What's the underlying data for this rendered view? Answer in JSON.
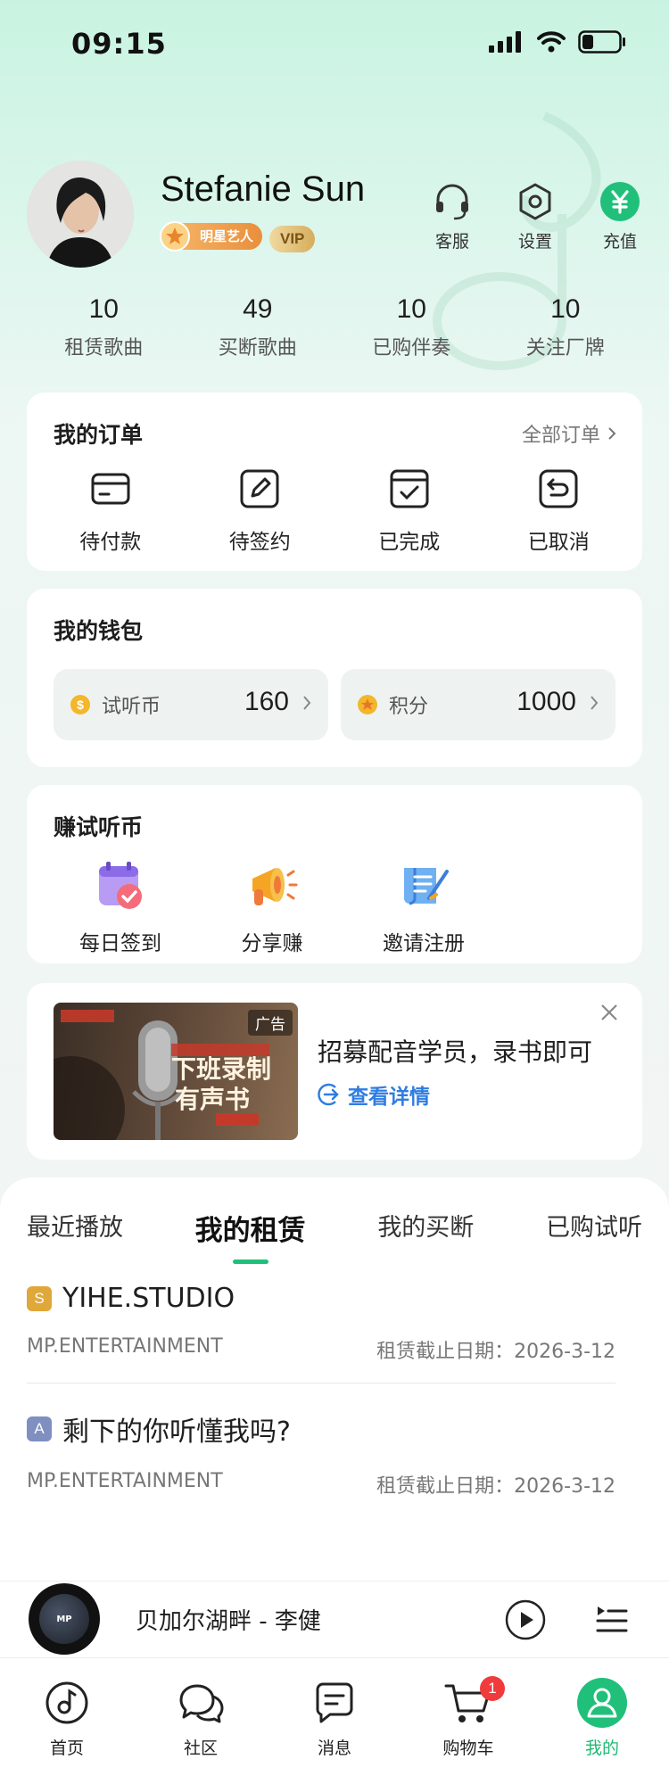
{
  "status_bar": {
    "time": "09:15"
  },
  "profile": {
    "name": "Stefanie Sun",
    "badge_star": "明星艺人",
    "badge_vip": "VIP",
    "actions": [
      {
        "label": "客服",
        "icon": "headset-icon"
      },
      {
        "label": "设置",
        "icon": "settings-hexagon-icon"
      },
      {
        "label": "充值",
        "icon": "yuan-icon"
      }
    ]
  },
  "stats": [
    {
      "value": "10",
      "label": "租赁歌曲"
    },
    {
      "value": "49",
      "label": "买断歌曲"
    },
    {
      "value": "10",
      "label": "已购伴奏"
    },
    {
      "value": "10",
      "label": "关注厂牌"
    }
  ],
  "orders": {
    "title": "我的订单",
    "all_link": "全部订单",
    "items": [
      {
        "label": "待付款",
        "icon": "card-icon"
      },
      {
        "label": "待签约",
        "icon": "sign-icon"
      },
      {
        "label": "已完成",
        "icon": "check-box-icon"
      },
      {
        "label": "已取消",
        "icon": "return-icon"
      }
    ]
  },
  "wallet": {
    "title": "我的钱包",
    "coins": {
      "label": "试听币",
      "value": "160"
    },
    "points": {
      "label": "积分",
      "value": "1000"
    }
  },
  "earn": {
    "title": "赚试听币",
    "items": [
      {
        "label": "每日签到",
        "icon": "calendar-icon"
      },
      {
        "label": "分享赚",
        "icon": "megaphone-icon"
      },
      {
        "label": "邀请注册",
        "icon": "scroll-icon"
      }
    ]
  },
  "ad": {
    "tag": "广告",
    "image_text_line1": "下班录制",
    "image_text_line2": "有声书",
    "title": "招募配音学员，录书即可",
    "link": "查看详情"
  },
  "library": {
    "tabs": [
      "最近播放",
      "我的租赁",
      "我的买断",
      "已购试听"
    ],
    "active_tab": 1,
    "items": [
      {
        "grade": "S",
        "grade_color": "#e0a73a",
        "title": "YIHE.STUDIO",
        "label": "MP.ENTERTAINMENT",
        "expiry": "租赁截止日期：2026-3-12"
      },
      {
        "grade": "A",
        "grade_color": "#7f8fc0",
        "title": "剩下的你听懂我吗?",
        "label": "MP.ENTERTAINMENT",
        "expiry": "租赁截止日期：2026-3-12"
      }
    ]
  },
  "player": {
    "song": "贝加尔湖畔 - 李健",
    "disc_text": "MP"
  },
  "tabbar": [
    {
      "label": "首页",
      "icon": "music-note-icon"
    },
    {
      "label": "社区",
      "icon": "chat-bubbles-icon"
    },
    {
      "label": "消息",
      "icon": "message-icon"
    },
    {
      "label": "购物车",
      "icon": "cart-icon",
      "badge": "1"
    },
    {
      "label": "我的",
      "icon": "user-icon",
      "active": true
    }
  ],
  "colors": {
    "accent": "#20c07a",
    "link": "#2f7de1",
    "badge": "#ef3b3b"
  }
}
